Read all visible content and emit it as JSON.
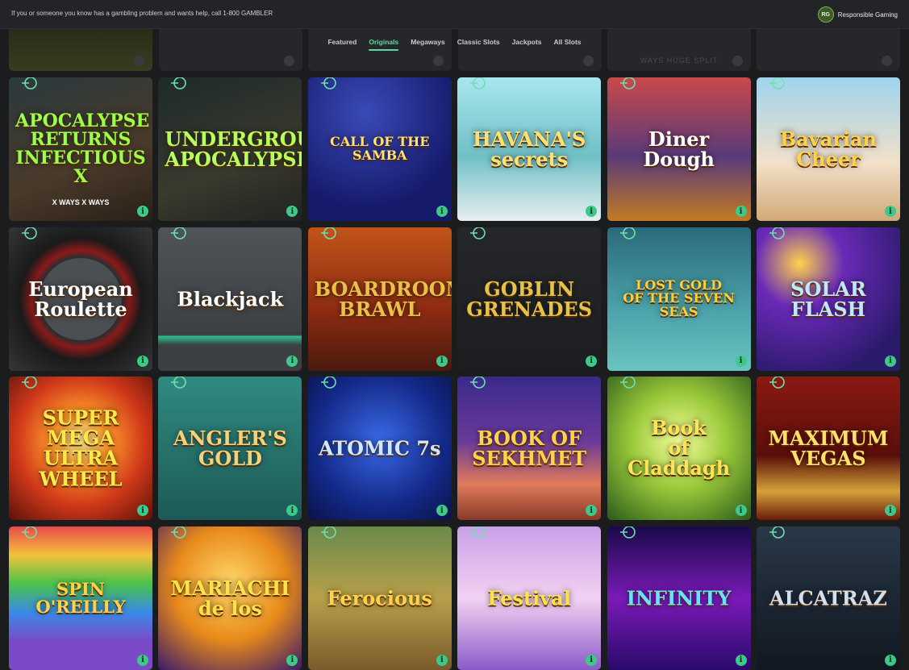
{
  "banner": {
    "message": "If you or someone you know has a gambling problem and wants help, call 1-800 GAMBLER",
    "rg_badge": "RG",
    "rg_label": "Responsible Gaming"
  },
  "nav": {
    "tabs": [
      {
        "label": "Featured",
        "active": false
      },
      {
        "label": "Originals",
        "active": true
      },
      {
        "label": "Megaways",
        "active": false
      },
      {
        "label": "Classic Slots",
        "active": false
      },
      {
        "label": "Jackpots",
        "active": false
      },
      {
        "label": "All Slots",
        "active": false
      }
    ]
  },
  "peek_row": {
    "visible_text": "WAYS HUGE SPLIT"
  },
  "games": [
    {
      "title": [
        "APOCALYPSE",
        "RETURNS",
        "INFECTIOUS X"
      ],
      "sub": "X WAYS   X WAYS",
      "bg": "linear-gradient(160deg,#2a3a3e,#4a3a2a 60%,#2a2018)",
      "color": "#9bff4a"
    },
    {
      "title": [
        "UNDERGROUND",
        "APOCALYPSE"
      ],
      "bg": "linear-gradient(160deg,#1e2a2a,#3a3a2e 60%,#222)",
      "color": "#b7ff5a"
    },
    {
      "title": [
        "CALL OF THE SAMBA"
      ],
      "bg": "radial-gradient(circle at 40% 25%,#3a4ab8,#151a6a 70%)",
      "color": "#ffe27a"
    },
    {
      "title": [
        "HAVANA'S",
        "secrets"
      ],
      "bg": "linear-gradient(180deg,#a8e6ee,#6fc0c6 55%,#e8eef0)",
      "color": "#ffe070"
    },
    {
      "title": [
        "Diner",
        "Dough"
      ],
      "bg": "linear-gradient(180deg,#c84a4a,#5a3a7a 55%,#c27a22)",
      "color": "#ffffff"
    },
    {
      "title": [
        "Bavarian",
        "Cheer"
      ],
      "bg": "linear-gradient(180deg,#9fd4ee,#f2e0c8 60%,#d2a878)",
      "color": "#ffd24a"
    },
    {
      "title": [
        "European",
        "Roulette"
      ],
      "bg": "radial-gradient(circle at 50% 50%,#4a4f54 40%,#2a2d30 41%,#8a1a1a 48%,#1a1a1a 60%,#343638)",
      "color": "#ffffff"
    },
    {
      "title": [
        "Blackjack"
      ],
      "bg": "linear-gradient(180deg,#4f5458,#3c4043 75%,#2fbf8c 76%,#3c4043 82%)",
      "color": "#ffffff"
    },
    {
      "title": [
        "BOARDROOM",
        "BRAWL"
      ],
      "bg": "linear-gradient(180deg,#c2541a,#8a2a12 60%,#4a1a0e)",
      "color": "#e8c04a"
    },
    {
      "title": [
        "GOBLIN",
        "GRENADES"
      ],
      "bg": "linear-gradient(180deg,#25272b,#1c1e21)",
      "color": "#e6c24a"
    },
    {
      "title": [
        "LOST GOLD",
        "OF THE SEVEN SEAS"
      ],
      "bg": "linear-gradient(180deg,#2a6a7a,#4aa0a8 55%,#6ac4c0)",
      "color": "#ffcf3a"
    },
    {
      "title": [
        "SOLAR",
        "FLASH"
      ],
      "bg": "radial-gradient(circle at 30% 25%,#ffd24a,#6a2ab8 30%,#2a1a6a 80%)",
      "color": "#bfe8ff"
    },
    {
      "title": [
        "SUPER MEGA",
        "ULTRA WHEEL"
      ],
      "bg": "radial-gradient(circle at 50% 45%,#fff4a0,#ff9a2a 25%,#d0381a 60%,#5a1208)",
      "color": "#ffe84a"
    },
    {
      "title": [
        "ANGLER'S",
        "GOLD"
      ],
      "bg": "linear-gradient(180deg,#2f8a80,#256e68 60%,#1d5a56)",
      "color": "#f2d27a"
    },
    {
      "title": [
        "ATOMIC 7s"
      ],
      "bg": "radial-gradient(circle at 50% 45%,#3a6ae8,#142a8a 60%,#0a1248)",
      "color": "#cfe8ff"
    },
    {
      "title": [
        "BOOK OF",
        "SEKHMET"
      ],
      "bg": "linear-gradient(180deg,#3a2a8a,#6a3a9a 45%,#e07a5a 75%,#8a3a2a)",
      "color": "#ffd24a"
    },
    {
      "title": [
        "Book",
        "of",
        "Claddagh"
      ],
      "bg": "radial-gradient(circle at 50% 45%,#f4ff9a,#9ac83a 45%,#2a5a1a)",
      "color": "#ffe45a"
    },
    {
      "title": [
        "MAXIMUM",
        "VEGAS"
      ],
      "bg": "linear-gradient(180deg,#8a1a12,#5a0e0a 55%,#d4a23a 80%,#6a1a0a)",
      "color": "#ffe06a"
    },
    {
      "title": [
        "SPIN O'REILLY"
      ],
      "bg": "linear-gradient(180deg,#e84a4a,#f2c23a 20%,#4ac24a 40%,#3a8ae8 60%,#7a4ac8 80%)",
      "color": "#ffd24a"
    },
    {
      "title": [
        "MARIACHI",
        "de los"
      ],
      "bg": "radial-gradient(circle at 50% 40%,#ffd86a,#e88a1a 50%,#3a1a6a)",
      "color": "#ffe24a"
    },
    {
      "title": [
        "Ferocious"
      ],
      "bg": "linear-gradient(180deg,#6a8a4a,#b8a04a 50%,#7a5a2a)",
      "color": "#ffd24a"
    },
    {
      "title": [
        "Festival"
      ],
      "bg": "linear-gradient(180deg,#c8a0e8,#f2d2f2 50%,#8a5ac8)",
      "color": "#ffe24a"
    },
    {
      "title": [
        "INFINITY"
      ],
      "bg": "linear-gradient(180deg,#1a0a4a,#7a1ab8 50%,#2a0a6a)",
      "color": "#6ae2ff"
    },
    {
      "title": [
        "ALCATRAZ"
      ],
      "bg": "linear-gradient(180deg,#2a3848,#1a2430 60%,#121820)",
      "color": "#cfe0f0"
    }
  ],
  "colors": {
    "accent": "#5fd6a0",
    "info": "#3cc98a",
    "page_bg": "#1b1c1e"
  }
}
